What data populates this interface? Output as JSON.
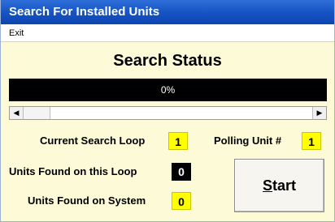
{
  "window": {
    "title": "Search For Installed Units"
  },
  "menu": {
    "items": [
      "Exit"
    ]
  },
  "status": {
    "heading": "Search Status",
    "progress_text": "0%",
    "progress_fraction": 0
  },
  "fields": {
    "current_loop_label": "Current Search Loop",
    "current_loop_value": "1",
    "polling_unit_label": "Polling Unit #",
    "polling_unit_value": "1",
    "found_loop_label": "Units Found on this Loop",
    "found_loop_value": "0",
    "found_system_label": "Units Found on System",
    "found_system_value": "0"
  },
  "buttons": {
    "start_first": "S",
    "start_rest": "tart"
  },
  "icons": {
    "scroll_left": "scroll-left-icon",
    "scroll_right": "scroll-right-icon"
  },
  "colors": {
    "title_bar": "#1552c2",
    "background": "#fcfad7",
    "value_highlight": "#ffff00",
    "progress_bg": "#000000"
  }
}
